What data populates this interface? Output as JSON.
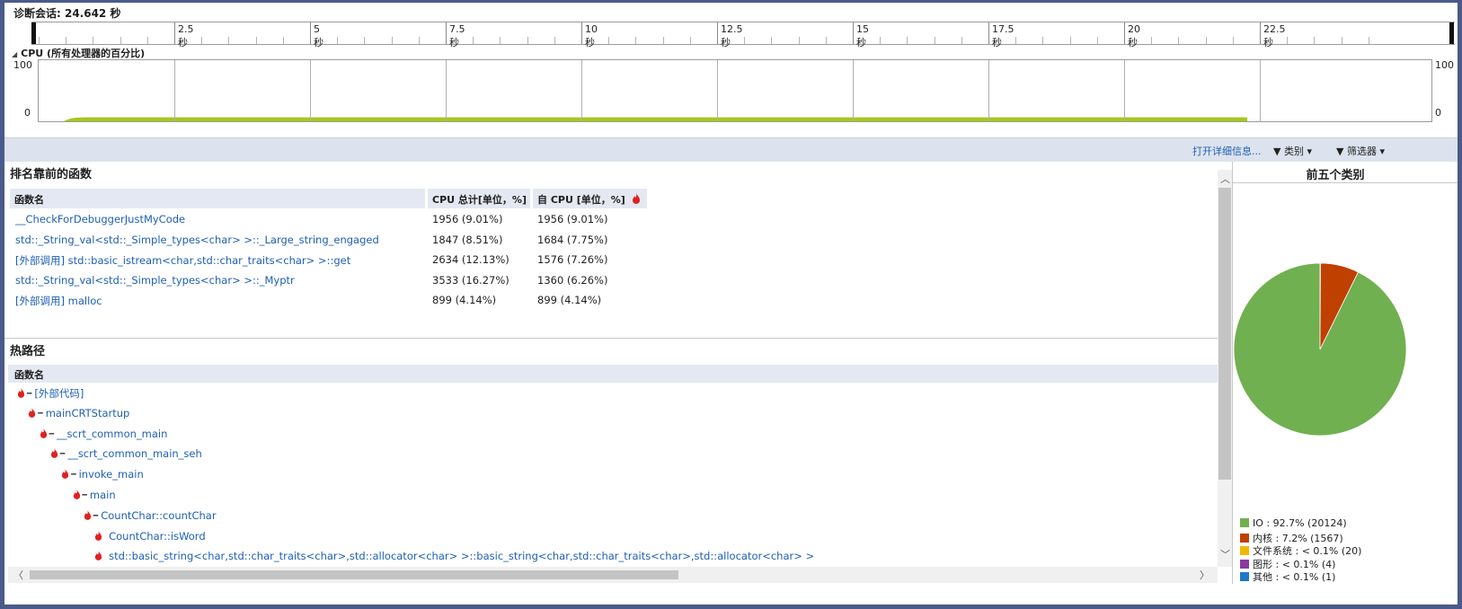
{
  "session": {
    "label": "诊断会话: 24.642 秒"
  },
  "ruler": {
    "labels": [
      "2.5秒",
      "5秒",
      "7.5秒",
      "10秒",
      "12.5秒",
      "15秒",
      "17.5秒",
      "20秒",
      "22.5秒"
    ]
  },
  "cpu": {
    "title": "CPU (所有处理器的百分比)",
    "y_max": "100",
    "y_min": "0",
    "color": "#a4c81c",
    "usage_percent": 2
  },
  "toolbar": {
    "details_link": "打开详细信息...",
    "category_label": "类别",
    "filter_label": "筛选器"
  },
  "top_functions": {
    "title": "排名靠前的函数",
    "columns": [
      "函数名",
      "CPU 总计[单位，%]",
      "自 CPU [单位，%]"
    ],
    "rows": [
      [
        "__CheckForDebuggerJustMyCode",
        "1956 (9.01%)",
        "1956 (9.01%)"
      ],
      [
        "std::_String_val<std::_Simple_types<char> >::_Large_string_engaged",
        "1847 (8.51%)",
        "1684 (7.75%)"
      ],
      [
        "[外部调用] std::basic_istream<char,std::char_traits<char> >::get",
        "2634 (12.13%)",
        "1576 (7.26%)"
      ],
      [
        "std::_String_val<std::_Simple_types<char> >::_Myptr",
        "3533 (16.27%)",
        "1360 (6.26%)"
      ],
      [
        "[外部调用] malloc",
        "899 (4.14%)",
        "899 (4.14%)"
      ]
    ]
  },
  "hot_path": {
    "title": "热路径",
    "column": "函数名",
    "items": [
      {
        "label": "[外部代码]",
        "level": 0,
        "expanded": true
      },
      {
        "label": "mainCRTStartup",
        "level": 1,
        "expanded": true
      },
      {
        "label": "__scrt_common_main",
        "level": 2,
        "expanded": true
      },
      {
        "label": "__scrt_common_main_seh",
        "level": 3,
        "expanded": true
      },
      {
        "label": "invoke_main",
        "level": 4,
        "expanded": true
      },
      {
        "label": "main",
        "level": 5,
        "expanded": true
      },
      {
        "label": "CountChar::countChar",
        "level": 6,
        "expanded": true
      },
      {
        "label": "CountChar::isWord",
        "level": 7,
        "expanded": false
      },
      {
        "label": "std::basic_string<char,std::char_traits<char>,std::allocator<char> >::basic_string<char,std::char_traits<char>,std::allocator<char> >",
        "level": 7,
        "expanded": false
      }
    ]
  },
  "categories": {
    "title": "前五个类别",
    "items": [
      {
        "label": "IO : 92.7% (20124)",
        "percent": 92.7,
        "color": "#70b050"
      },
      {
        "label": "内核 : 7.2% (1567)",
        "percent": 7.2,
        "color": "#c04000"
      },
      {
        "label": "文件系统 : < 0.1% (20)",
        "percent": 0.05,
        "color": "#f0b800"
      },
      {
        "label": "图形 : < 0.1% (4)",
        "percent": 0.02,
        "color": "#8a3a9a"
      },
      {
        "label": "其他 : < 0.1% (1)",
        "percent": 0.01,
        "color": "#1e78c8"
      }
    ]
  }
}
